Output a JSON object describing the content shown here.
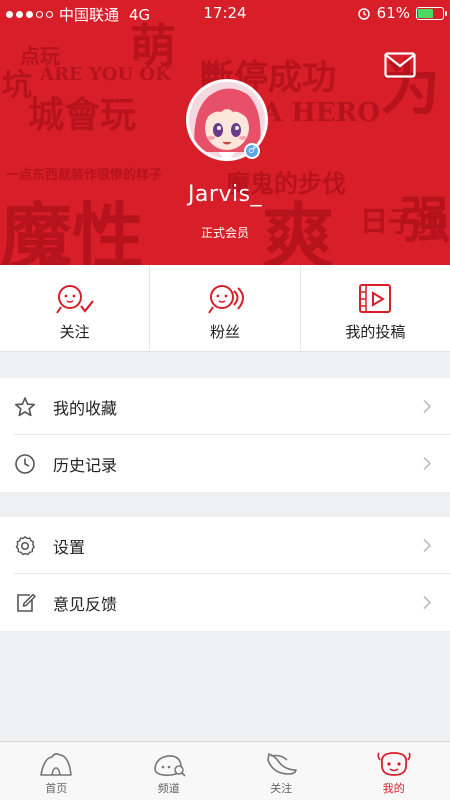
{
  "status_bar": {
    "carrier": "中国联通",
    "network": "4G",
    "time": "17:24",
    "battery": "61%",
    "battery_level": 0.61
  },
  "colors": {
    "brand": "#d81e28",
    "brand_dark": "#b4121b",
    "battery_green": "#4cd964",
    "gender_badge": "#58a6e8"
  },
  "background_text": [
    "魔性",
    "爽",
    "城會玩",
    "ARE YOU OK",
    "A HERO",
    "萌",
    "斷停成功",
    "魔鬼的步伐",
    "一点东西就装作很惨的样子",
    "点玩",
    "为",
    "日子狗",
    "强",
    "坑"
  ],
  "profile": {
    "username": "Jarvis_",
    "member_level": "正式会员",
    "avatar_icon": "anime-avatar",
    "gender_icon": "male-icon"
  },
  "actions": [
    {
      "label": "关注",
      "icon": "follow-icon"
    },
    {
      "label": "粉丝",
      "icon": "fans-icon"
    },
    {
      "label": "我的投稿",
      "icon": "video-upload-icon"
    }
  ],
  "menu_group_1": [
    {
      "label": "我的收藏",
      "icon": "star-icon"
    },
    {
      "label": "历史记录",
      "icon": "clock-icon"
    }
  ],
  "menu_group_2": [
    {
      "label": "设置",
      "icon": "gear-icon"
    },
    {
      "label": "意见反馈",
      "icon": "edit-icon"
    }
  ],
  "tabs": [
    {
      "label": "首页",
      "icon": "home-icon",
      "active": false
    },
    {
      "label": "频道",
      "icon": "channel-icon",
      "active": false
    },
    {
      "label": "关注",
      "icon": "banana-icon",
      "active": false
    },
    {
      "label": "我的",
      "icon": "mine-icon",
      "active": true
    }
  ]
}
